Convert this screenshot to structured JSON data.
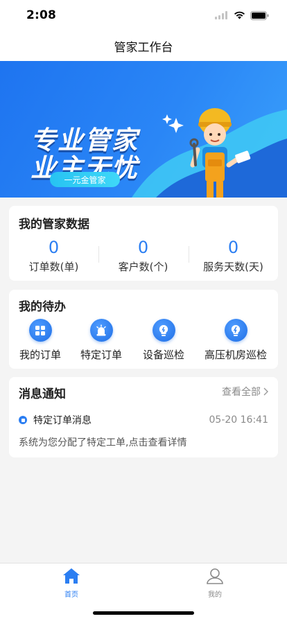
{
  "status_bar": {
    "time": "2:08"
  },
  "nav": {
    "title": "管家工作台"
  },
  "banner": {
    "line1": "专业管家",
    "line2": "业主无忧",
    "pill": "一元金管家"
  },
  "data_card": {
    "title": "我的管家数据",
    "stats": [
      {
        "value": "0",
        "label": "订单数(单)"
      },
      {
        "value": "0",
        "label": "客户数(个)"
      },
      {
        "value": "0",
        "label": "服务天数(天)"
      }
    ]
  },
  "todo_card": {
    "title": "我的待办",
    "items": [
      {
        "label": "我的订单",
        "icon": "grid-icon"
      },
      {
        "label": "特定订单",
        "icon": "siren-icon"
      },
      {
        "label": "设备巡检",
        "icon": "bulb-icon"
      },
      {
        "label": "高压机房巡检",
        "icon": "bulb-bolt-icon"
      }
    ]
  },
  "message_card": {
    "title": "消息通知",
    "more": "查看全部",
    "messages": [
      {
        "title": "特定订单消息",
        "time": "05-20 16:41",
        "body": "系统为您分配了特定工单,点击查看详情"
      }
    ]
  },
  "tabbar": {
    "items": [
      {
        "label": "首页",
        "icon": "home-icon",
        "active": true
      },
      {
        "label": "我的",
        "icon": "user-icon",
        "active": false
      }
    ]
  },
  "colors": {
    "accent": "#2b7ef2",
    "banner": "#2a86f6",
    "background": "#f4f4f4"
  }
}
